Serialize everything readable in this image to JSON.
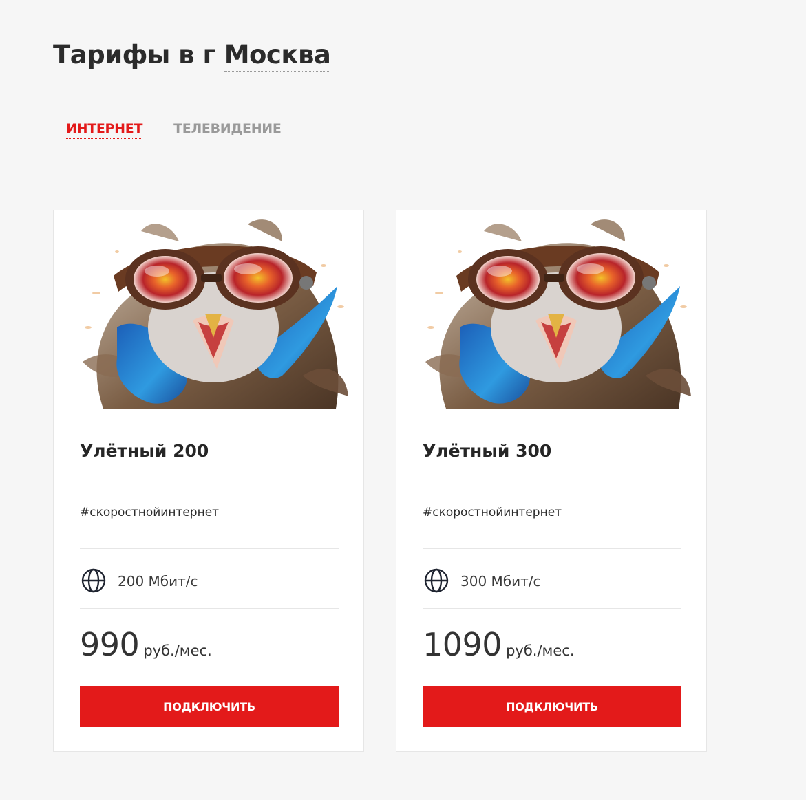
{
  "page": {
    "title_prefix": "Тарифы в г",
    "city": "Москва"
  },
  "tabs": [
    {
      "label": "ИНТЕРНЕТ",
      "active": true
    },
    {
      "label": "ТЕЛЕВИДЕНИЕ",
      "active": false
    }
  ],
  "cards": [
    {
      "name": "Улётный 200",
      "hashtag": "#скоростнойинтернет",
      "speed": "200 Мбит/с",
      "price": "990",
      "price_unit": "руб./мес.",
      "button": "ПОДКЛЮЧИТЬ",
      "image_icon": "owl-with-goggles-illustration"
    },
    {
      "name": "Улётный 300",
      "hashtag": "#скоростнойинтернет",
      "speed": "300 Мбит/с",
      "price": "1090",
      "price_unit": "руб./мес.",
      "button": "ПОДКЛЮЧИТЬ",
      "image_icon": "owl-with-goggles-illustration"
    }
  ],
  "colors": {
    "accent": "#e31a1a",
    "background": "#f6f6f6",
    "card": "#ffffff",
    "muted_tab": "#9a9a9a"
  }
}
